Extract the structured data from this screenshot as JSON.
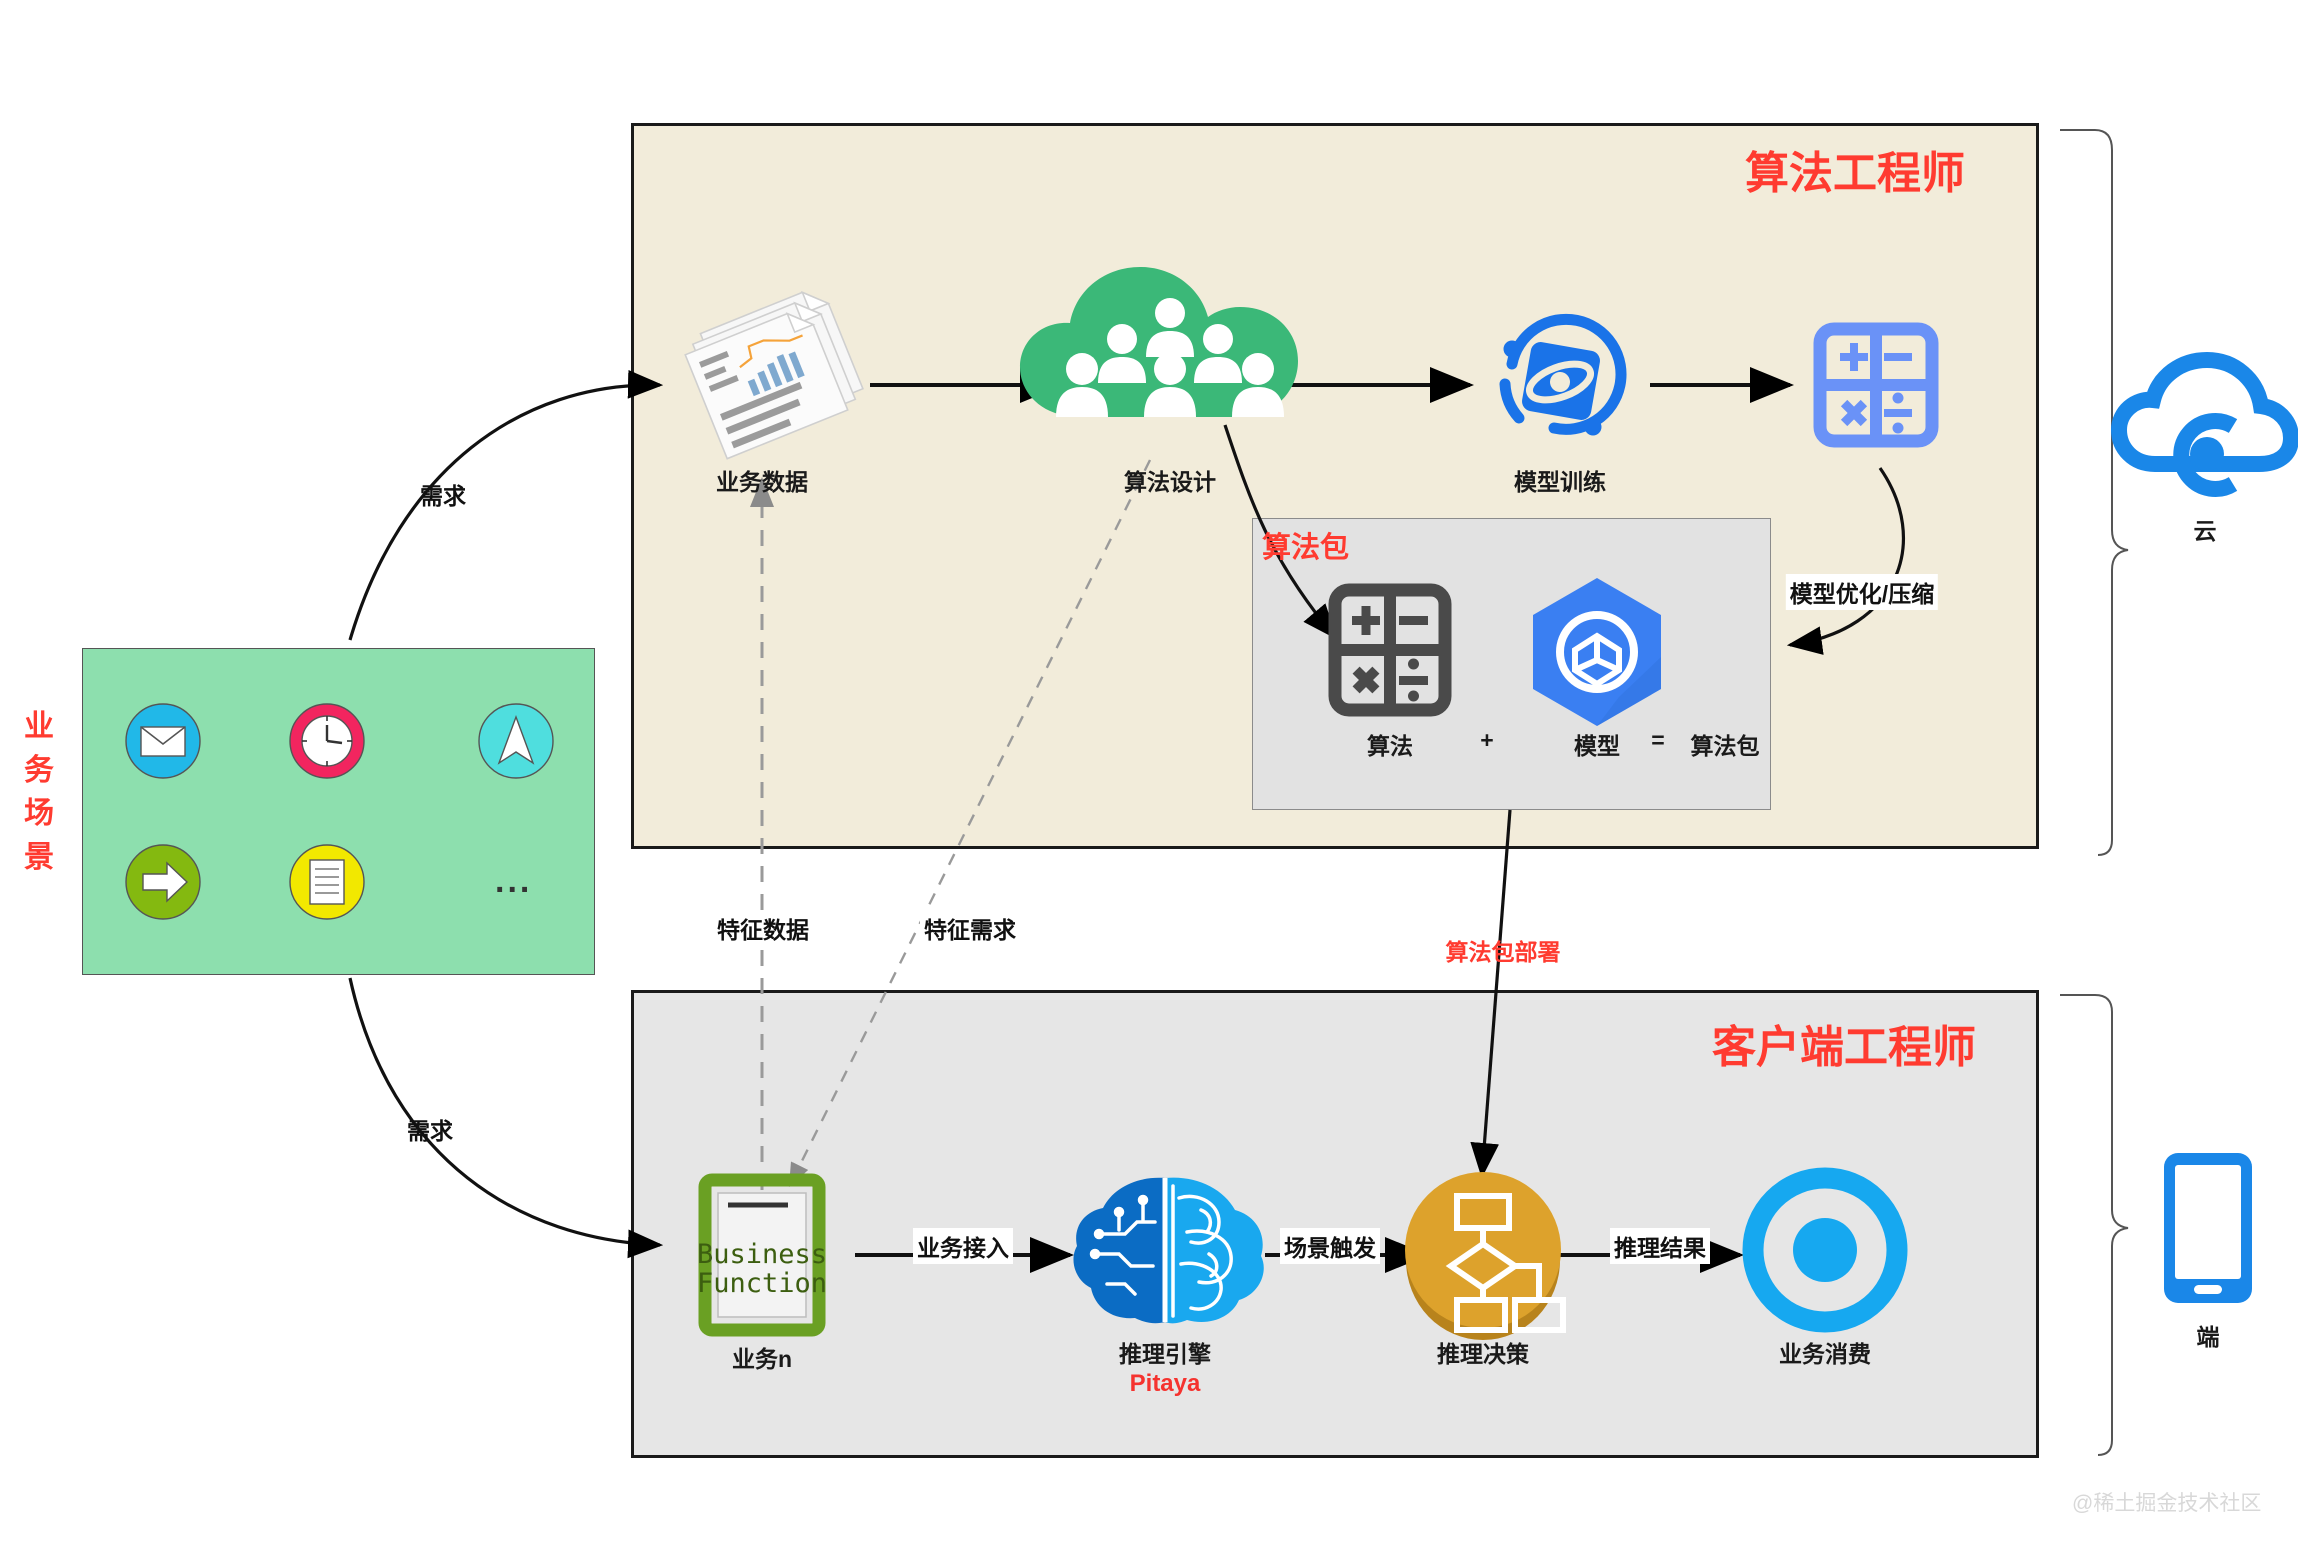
{
  "diagram": {
    "title_cloud_section": "算法工程师",
    "title_client_section": "客户端工程师",
    "scenario_label": "业务场景",
    "watermark": "@稀土掘金技术社区"
  },
  "colors": {
    "cloud_panel_bg": "#f2ecda",
    "client_panel_bg": "#e6e6e6",
    "scenario_bg": "#8ddfae",
    "accent_red": "#ff3b30",
    "blue": "#1a73e8",
    "light_blue": "#6a92f7",
    "green_cloud": "#3bb878",
    "gold": "#d79b26",
    "cyan": "#00a8e8",
    "business_green": "#6aa023",
    "pitaya_red": "#f5332f"
  },
  "scenario": {
    "label": "业务场景",
    "icons": [
      {
        "name": "mail-icon",
        "color": "#21b8e8"
      },
      {
        "name": "clock-icon",
        "color": "#f2255f"
      },
      {
        "name": "navigation-icon",
        "color": "#4fdede"
      },
      {
        "name": "arrow-right-icon",
        "color": "#84b910"
      },
      {
        "name": "document-icon",
        "color": "#f2e800"
      },
      {
        "name": "ellipsis-icon",
        "color": "#333333"
      }
    ],
    "ellipsis": "..."
  },
  "cloud_section": {
    "title": "算法工程师",
    "bracket_label": "云",
    "bracket_icon": "cloud-icon",
    "nodes": [
      {
        "id": "business-data",
        "label": "业务数据",
        "icon": "documents-stack-icon"
      },
      {
        "id": "algorithm-design",
        "label": "算法设计",
        "icon": "cloud-people-icon"
      },
      {
        "id": "model-training",
        "label": "模型训练",
        "icon": "model-training-icon"
      },
      {
        "id": "calculator",
        "label": "",
        "icon": "calculator-icon"
      }
    ],
    "package_box": {
      "title": "算法包",
      "algorithm_label": "算法",
      "plus_label": "+",
      "model_label": "模型",
      "equals_label": "=",
      "result_label": "算法包",
      "algorithm_icon": "calculator-dark-icon",
      "model_icon": "hexagon-model-icon"
    }
  },
  "client_section": {
    "title": "客户端工程师",
    "bracket_label": "端",
    "bracket_icon": "mobile-phone-icon",
    "nodes": [
      {
        "id": "business-n",
        "label": "业务n",
        "sublabel": "",
        "icon": "business-function-icon",
        "icon_text_line1": "Business",
        "icon_text_line2": "Function"
      },
      {
        "id": "inference-engine",
        "label": "推理引擎",
        "sublabel": "Pitaya",
        "icon": "brain-icon"
      },
      {
        "id": "inference-decision",
        "label": "推理决策",
        "sublabel": "",
        "icon": "decision-flow-icon"
      },
      {
        "id": "business-consume",
        "label": "业务消费",
        "sublabel": "",
        "icon": "target-icon"
      }
    ]
  },
  "edges": [
    {
      "id": "req-top",
      "label": "需求"
    },
    {
      "id": "req-bottom",
      "label": "需求"
    },
    {
      "id": "feature-data",
      "label": "特征数据"
    },
    {
      "id": "feature-req",
      "label": "特征需求"
    },
    {
      "id": "model-opt",
      "label": "模型优化/压缩"
    },
    {
      "id": "pkg-deploy",
      "label": "算法包部署"
    },
    {
      "id": "biz-access",
      "label": "业务接入"
    },
    {
      "id": "scene-trigger",
      "label": "场景触发"
    },
    {
      "id": "infer-result",
      "label": "推理结果"
    }
  ]
}
